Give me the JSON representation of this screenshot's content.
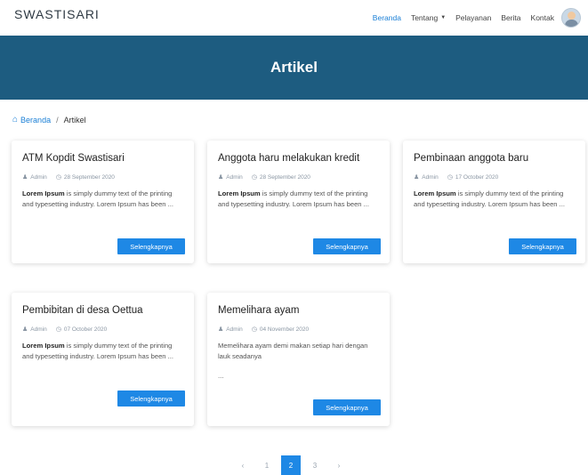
{
  "brand": "SWASTISARI",
  "nav": {
    "items": [
      {
        "label": "Beranda",
        "active": true
      },
      {
        "label": "Tentang",
        "dropdown": true
      },
      {
        "label": "Pelayanan"
      },
      {
        "label": "Berita"
      },
      {
        "label": "Kontak"
      }
    ],
    "caret_icon": "chevron-down-icon",
    "avatar_icon": "user-avatar-icon"
  },
  "banner": {
    "title": "Artikel"
  },
  "breadcrumb": {
    "home": "Beranda",
    "separator": "/",
    "current": "Artikel"
  },
  "articles": [
    {
      "title": "ATM Kopdit Swastisari",
      "author": "Admin",
      "date": "28 September 2020",
      "excerpt_bold": "Lorem Ipsum",
      "excerpt": " is simply dummy text of the printing and typesetting industry. Lorem Ipsum has been ...",
      "button": "Selengkapnya"
    },
    {
      "title": "Anggota haru melakukan kredit",
      "author": "Admin",
      "date": "28 September 2020",
      "excerpt_bold": "Lorem Ipsum",
      "excerpt": " is simply dummy text of the printing and typesetting industry. Lorem Ipsum has been ...",
      "button": "Selengkapnya"
    },
    {
      "title": "Pembinaan anggota baru",
      "author": "Admin",
      "date": "17 October 2020",
      "excerpt_bold": "Lorem Ipsum",
      "excerpt": " is simply dummy text of the printing and typesetting industry. Lorem Ipsum has been ...",
      "button": "Selengkapnya"
    },
    {
      "title": "Pembibitan di desa Oettua",
      "author": "Admin",
      "date": "07 October 2020",
      "excerpt_bold": "Lorem Ipsum",
      "excerpt": " is simply dummy text of the printing and typesetting industry. Lorem Ipsum has been ...",
      "button": "Selengkapnya"
    },
    {
      "title": "Memelihara ayam",
      "author": "Admin",
      "date": "04 November 2020",
      "excerpt_line": "Memelihara ayam demi makan setiap hari dengan lauk seadanya",
      "excerpt_tail": "...",
      "button": "Selengkapnya"
    }
  ],
  "pagination": {
    "prev": "‹",
    "pages": [
      "1",
      "2",
      "3"
    ],
    "active": "2",
    "next": "›"
  },
  "colors": {
    "banner": "#1d5c80",
    "accent": "#1e88e5",
    "link": "#1a7fd6"
  }
}
